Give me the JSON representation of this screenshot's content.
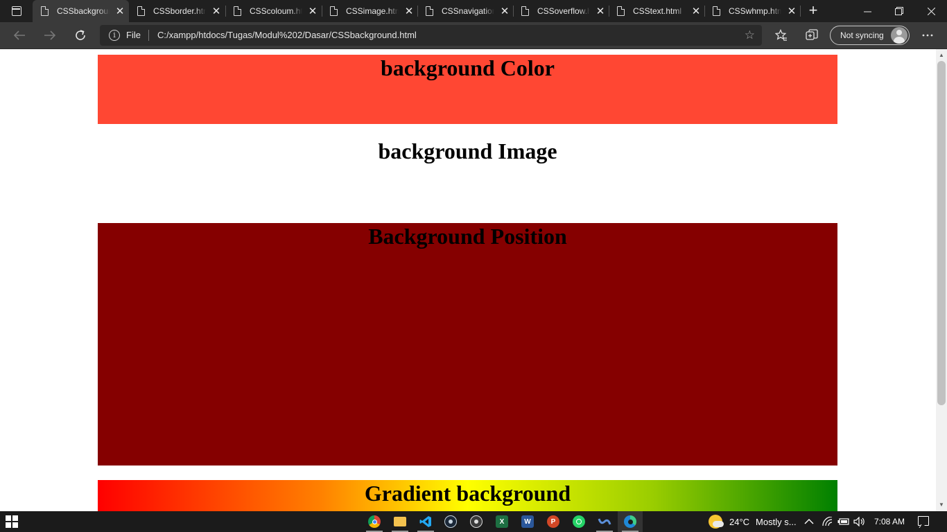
{
  "browser": {
    "tabs": [
      {
        "title": "CSSbackground.html",
        "active": true
      },
      {
        "title": "CSSborder.html",
        "active": false
      },
      {
        "title": "CSScoloum.html",
        "active": false
      },
      {
        "title": "CSSimage.html",
        "active": false
      },
      {
        "title": "CSSnavigation.html",
        "active": false
      },
      {
        "title": "CSSoverflow.html",
        "active": false
      },
      {
        "title": "CSStext.html",
        "active": false
      },
      {
        "title": "CSSwhmp.html",
        "active": false
      }
    ],
    "address": {
      "scheme_label": "File",
      "url": "C:/xampp/htdocs/Tugas/Modul%202/Dasar/CSSbackground.html"
    },
    "profile": {
      "label": "Not syncing"
    }
  },
  "page": {
    "sections": [
      {
        "heading": "background Color",
        "bg": "#ff4733"
      },
      {
        "heading": "background Image",
        "bg": "#ffffff"
      },
      {
        "heading": "Background Position",
        "bg": "#850000"
      },
      {
        "heading": "Gradient background",
        "gradient": [
          "#ff0000",
          "#ff8000",
          "#ffff00",
          "#9acd00",
          "#008000"
        ]
      }
    ]
  },
  "taskbar": {
    "apps": [
      "chrome-icon",
      "file-explorer-icon",
      "vscode-icon",
      "steam-icon",
      "obs-icon",
      "excel-icon",
      "word-icon",
      "powerpoint-icon",
      "whatsapp-icon",
      "webex-icon",
      "edge-icon"
    ],
    "weather": {
      "temp": "24°C",
      "condition": "Mostly s..."
    },
    "time": "7:08 AM"
  }
}
